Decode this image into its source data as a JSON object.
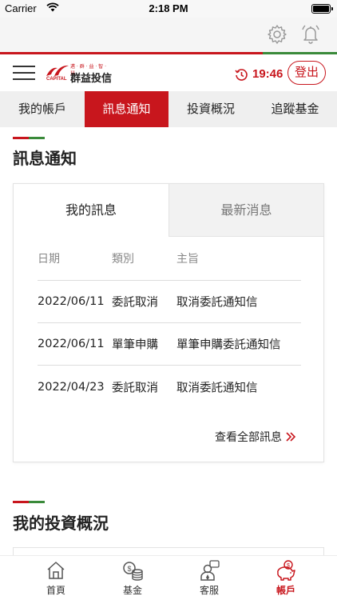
{
  "status_bar": {
    "carrier": "Carrier",
    "time": "2:18 PM"
  },
  "header": {
    "brand_name": "群益投信",
    "brand_tagline": "邁 · 群 · 益 · 智 · 慧",
    "brand_capital": "CAPITAL",
    "session_time": "19:46",
    "login_label": "登出"
  },
  "tabs": [
    {
      "label": "我的帳戶",
      "active": false
    },
    {
      "label": "訊息通知",
      "active": true
    },
    {
      "label": "投資概況",
      "active": false
    },
    {
      "label": "追蹤基金",
      "active": false
    }
  ],
  "notifications": {
    "title": "訊息通知",
    "card_tabs": {
      "my_messages": "我的訊息",
      "latest_news": "最新消息"
    },
    "columns": {
      "date": "日期",
      "type": "類別",
      "subject": "主旨"
    },
    "rows": [
      {
        "date": "2022/06/11",
        "type": "委託取消",
        "subject": "取消委託通知信"
      },
      {
        "date": "2022/06/11",
        "type": "單筆申購",
        "subject": "單筆申購委託通知信"
      },
      {
        "date": "2022/04/23",
        "type": "委託取消",
        "subject": "取消委託通知信"
      }
    ],
    "view_all": "查看全部訊息"
  },
  "overview": {
    "title": "我的投資概況"
  },
  "bottom_nav": [
    {
      "label": "首頁",
      "icon": "home-icon",
      "active": false
    },
    {
      "label": "基金",
      "icon": "coins-icon",
      "active": false
    },
    {
      "label": "客服",
      "icon": "service-agent-icon",
      "active": false
    },
    {
      "label": "帳戶",
      "icon": "piggy-bank-icon",
      "active": true
    }
  ],
  "colors": {
    "accent": "#c8161d",
    "accent_green": "#3a8a3a",
    "tab_bg": "#efefef"
  }
}
